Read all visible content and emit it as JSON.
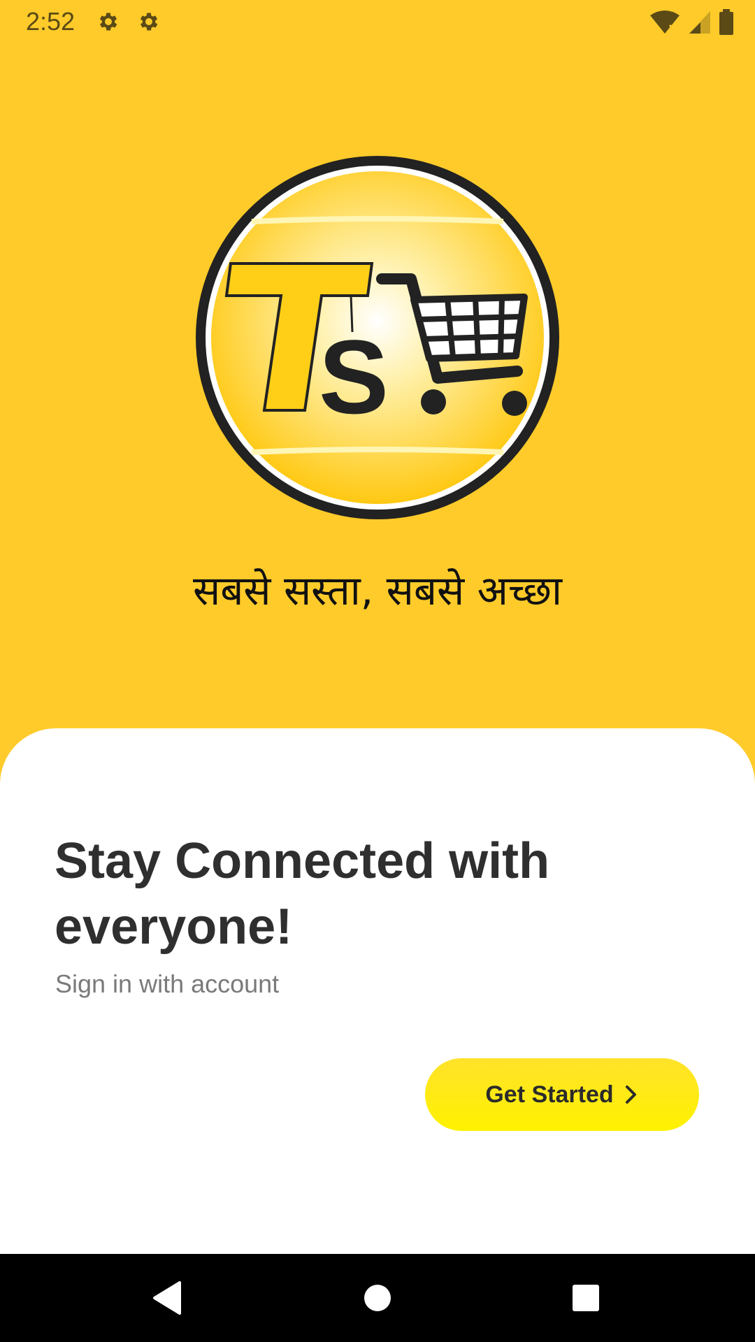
{
  "status_bar": {
    "time": "2:52",
    "left_icons": [
      "gear-icon",
      "gear-icon"
    ],
    "right_icons": [
      "wifi-icon",
      "cell-signal-icon",
      "battery-icon"
    ]
  },
  "logo": {
    "icon": "ts-shopping-cart-logo",
    "letters": "Ts"
  },
  "tagline": "सबसे सस्ता, सबसे अच्छा",
  "welcome": {
    "headline": "Stay Connected with everyone!",
    "subtitle": "Sign in with account",
    "button_label": "Get Started",
    "button_icon": "chevron-right-icon"
  },
  "nav_bar": {
    "buttons": [
      "back-icon",
      "home-icon",
      "recents-icon"
    ]
  },
  "colors": {
    "background": "#FFCB2A",
    "sheet": "#FFFFFF",
    "button": "#FFEA12",
    "text_dark": "#2F2F2F",
    "text_muted": "#7A7A7A"
  }
}
